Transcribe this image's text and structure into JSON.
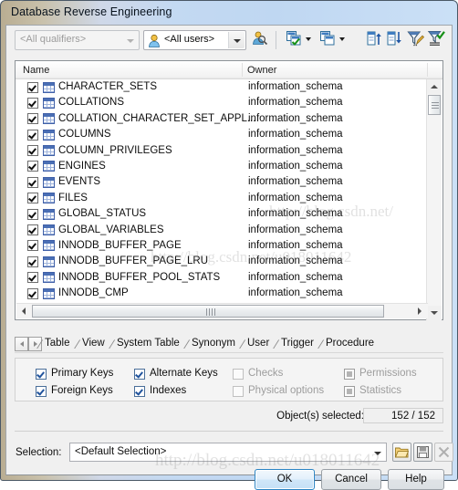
{
  "window": {
    "title": "Database Reverse Engineering"
  },
  "toolbar": {
    "qualifier_combo": {
      "value": "<All qualifiers>",
      "disabled": true
    },
    "user_combo": {
      "value": "<All users>",
      "icon": "user-icon"
    },
    "buttons": [
      {
        "name": "find-user-button",
        "icon": "user-search-icon"
      },
      {
        "name": "select-all-button",
        "icon": "select-all-icon",
        "has_dropdown": true
      },
      {
        "name": "deselect-all-button",
        "icon": "deselect-all-icon",
        "has_dropdown": true
      },
      {
        "name": "sort-ascending-button",
        "icon": "sort-ascending-icon"
      },
      {
        "name": "sort-descending-button",
        "icon": "sort-descending-icon"
      },
      {
        "name": "edit-filter-button",
        "icon": "filter-edit-icon"
      },
      {
        "name": "apply-filter-button",
        "icon": "filter-apply-icon"
      }
    ]
  },
  "list": {
    "columns": [
      "Name",
      "Owner"
    ],
    "rows": [
      {
        "checked": true,
        "name": "CHARACTER_SETS",
        "owner": "information_schema"
      },
      {
        "checked": true,
        "name": "COLLATIONS",
        "owner": "information_schema"
      },
      {
        "checked": true,
        "name": "COLLATION_CHARACTER_SET_APPL...",
        "owner": "information_schema"
      },
      {
        "checked": true,
        "name": "COLUMNS",
        "owner": "information_schema"
      },
      {
        "checked": true,
        "name": "COLUMN_PRIVILEGES",
        "owner": "information_schema"
      },
      {
        "checked": true,
        "name": "ENGINES",
        "owner": "information_schema"
      },
      {
        "checked": true,
        "name": "EVENTS",
        "owner": "information_schema"
      },
      {
        "checked": true,
        "name": "FILES",
        "owner": "information_schema"
      },
      {
        "checked": true,
        "name": "GLOBAL_STATUS",
        "owner": "information_schema"
      },
      {
        "checked": true,
        "name": "GLOBAL_VARIABLES",
        "owner": "information_schema"
      },
      {
        "checked": true,
        "name": "INNODB_BUFFER_PAGE",
        "owner": "information_schema"
      },
      {
        "checked": true,
        "name": "INNODB_BUFFER_PAGE_LRU",
        "owner": "information_schema"
      },
      {
        "checked": true,
        "name": "INNODB_BUFFER_POOL_STATS",
        "owner": "information_schema"
      },
      {
        "checked": true,
        "name": "INNODB_CMP",
        "owner": "information_schema"
      }
    ]
  },
  "tabs": [
    {
      "label": "Table",
      "active": true
    },
    {
      "label": "View",
      "active": false
    },
    {
      "label": "System Table",
      "active": false
    },
    {
      "label": "Synonym",
      "active": false
    },
    {
      "label": "User",
      "active": false
    },
    {
      "label": "Trigger",
      "active": false
    },
    {
      "label": "Procedure",
      "active": false
    }
  ],
  "options": [
    {
      "label": "Primary Keys",
      "state": "checked"
    },
    {
      "label": "Foreign Keys",
      "state": "checked"
    },
    {
      "label": "Alternate Keys",
      "state": "checked"
    },
    {
      "label": "Indexes",
      "state": "checked"
    },
    {
      "label": "Checks",
      "state": "disabled"
    },
    {
      "label": "Physical options",
      "state": "disabled"
    },
    {
      "label": "Permissions",
      "state": "greyfill"
    },
    {
      "label": "Statistics",
      "state": "greyfill"
    }
  ],
  "status": {
    "objects_label": "Object(s) selected:",
    "objects_value": "152 / 152"
  },
  "selection": {
    "label": "Selection:",
    "value": "<Default Selection>",
    "buttons": [
      {
        "name": "open-selection-button",
        "icon": "folder-open-icon"
      },
      {
        "name": "save-selection-button",
        "icon": "save-icon"
      },
      {
        "name": "delete-selection-button",
        "icon": "delete-x-icon",
        "disabled": true
      }
    ]
  },
  "footer": {
    "ok": "OK",
    "cancel": "Cancel",
    "help": "Help"
  },
  "watermark": {
    "line1": "http://blog.csdn.net/",
    "line2": "http://blog.csdn.net/u018011642"
  }
}
